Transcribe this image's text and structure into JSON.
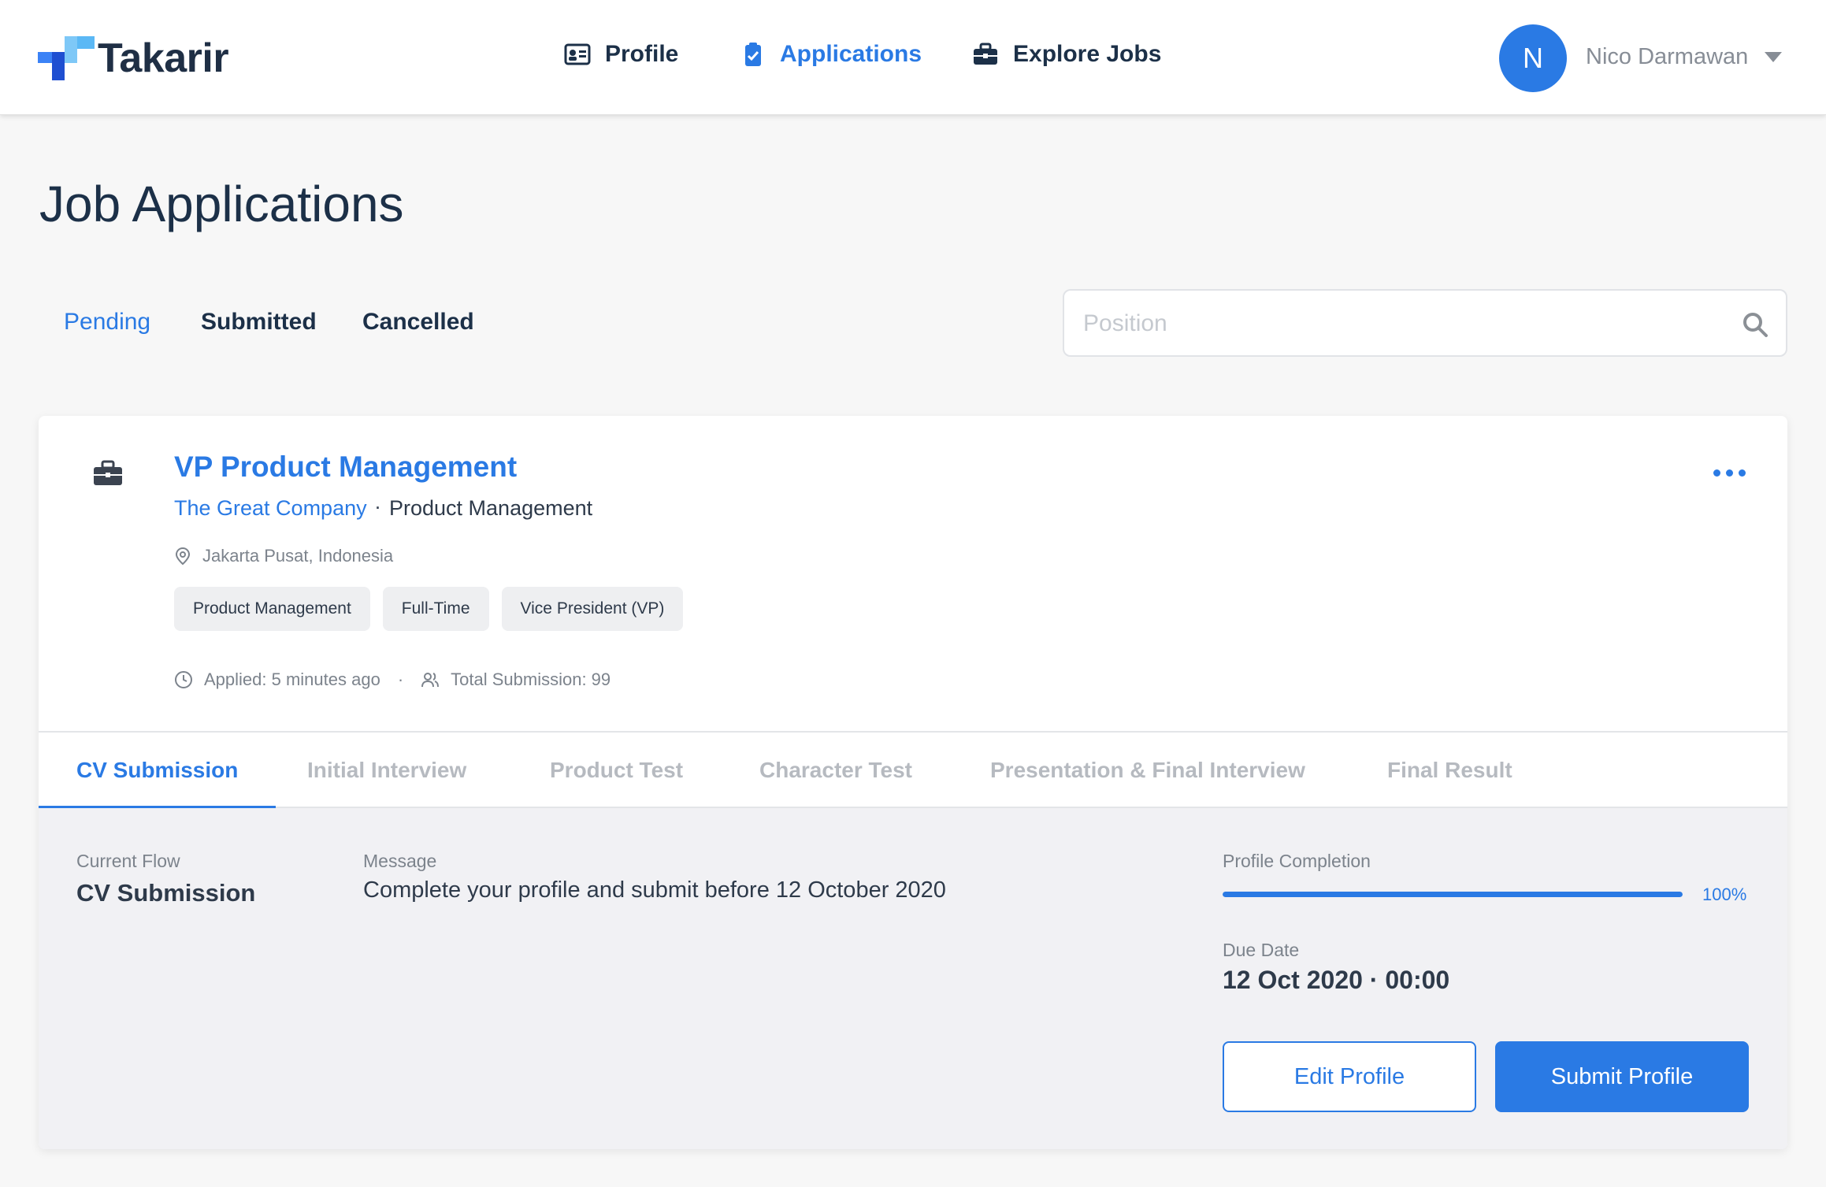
{
  "brand": {
    "name": "Takarir",
    "accent": "#2a7ae4",
    "dark": "#1c3048"
  },
  "nav": {
    "items": [
      {
        "label": "Profile",
        "icon": "id-card-icon",
        "active": false
      },
      {
        "label": "Applications",
        "icon": "clipboard-check-icon",
        "active": true
      },
      {
        "label": "Explore Jobs",
        "icon": "briefcase-icon",
        "active": false
      }
    ],
    "user": {
      "initial": "N",
      "name": "Nico Darmawan"
    }
  },
  "page": {
    "title": "Job Applications",
    "filters": [
      "Pending",
      "Submitted",
      "Cancelled"
    ],
    "active_filter": "Pending",
    "search": {
      "placeholder": "Position",
      "value": ""
    }
  },
  "job": {
    "title": "VP Product Management",
    "company": "The Great Company",
    "separator": "·",
    "department": "Product Management",
    "location": "Jakarta Pusat, Indonesia",
    "tags": [
      "Product Management",
      "Full-Time",
      "Vice President (VP)"
    ],
    "applied": "Applied: 5 minutes ago",
    "meta_separator": "·",
    "total_submission": "Total Submission: 99"
  },
  "stages": {
    "tabs": [
      "CV Submission",
      "Initial Interview",
      "Product Test",
      "Character Test",
      "Presentation & Final Interview",
      "Final Result"
    ],
    "active": 0
  },
  "details": {
    "current_flow_label": "Current Flow",
    "current_flow_value": "CV Submission",
    "message_label": "Message",
    "message_value": "Complete your profile and submit before 12 October 2020",
    "profile_completion_label": "Profile Completion",
    "profile_completion_percent": 100,
    "profile_completion_text": "100%",
    "due_date_label": "Due Date",
    "due_date_value": "12 Oct 2020 · 00:00",
    "edit_button": "Edit Profile",
    "submit_button": "Submit Profile"
  }
}
